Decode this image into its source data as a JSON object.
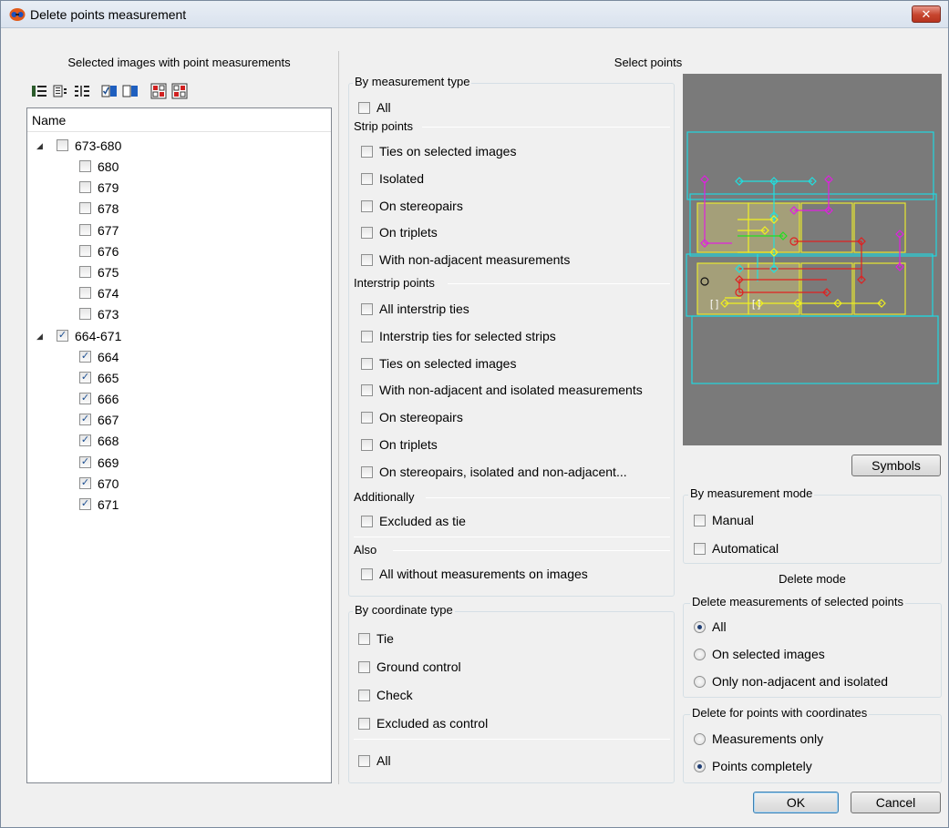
{
  "window": {
    "title": "Delete points measurement",
    "close_label": "✕"
  },
  "left": {
    "header": "Selected images with point measurements",
    "tree_column": "Name",
    "toolbar_icons": [
      "expand-all-icon",
      "collapse-all-icon",
      "tree-view-icon",
      "select-all-icon",
      "deselect-all-icon",
      "check-marked-icon",
      "uncheck-marked-icon"
    ],
    "tree": [
      {
        "label": "673-680",
        "checked": false,
        "children": [
          {
            "label": "680",
            "checked": false
          },
          {
            "label": "679",
            "checked": false
          },
          {
            "label": "678",
            "checked": false
          },
          {
            "label": "677",
            "checked": false
          },
          {
            "label": "676",
            "checked": false
          },
          {
            "label": "675",
            "checked": false
          },
          {
            "label": "674",
            "checked": false
          },
          {
            "label": "673",
            "checked": false
          }
        ]
      },
      {
        "label": "664-671",
        "checked": true,
        "children": [
          {
            "label": "664",
            "checked": true
          },
          {
            "label": "665",
            "checked": true
          },
          {
            "label": "666",
            "checked": true
          },
          {
            "label": "667",
            "checked": true
          },
          {
            "label": "668",
            "checked": true
          },
          {
            "label": "669",
            "checked": true
          },
          {
            "label": "670",
            "checked": true
          },
          {
            "label": "671",
            "checked": true
          }
        ]
      }
    ]
  },
  "select_points": {
    "header": "Select points",
    "by_measurement_type": {
      "title": "By measurement type",
      "all": "All",
      "strip_points_title": "Strip points",
      "strip_points": [
        "Ties on selected images",
        "Isolated",
        "On stereopairs",
        "On triplets",
        "With non-adjacent measurements"
      ],
      "interstrip_title": "Interstrip points",
      "interstrip_points": [
        "All interstrip ties",
        "Interstrip ties for selected strips",
        "Ties on selected images",
        "With non-adjacent and isolated measurements",
        "On stereopairs",
        "On triplets",
        "On stereopairs, isolated and non-adjacent..."
      ],
      "additionally_title": "Additionally",
      "additionally": [
        "Excluded as tie"
      ],
      "also_title": "Also",
      "also": [
        "All without measurements on images"
      ]
    },
    "by_coordinate_type": {
      "title": "By coordinate type",
      "items": [
        "Tie",
        "Ground control",
        "Check",
        "Excluded as control"
      ],
      "all": "All"
    },
    "symbols_button": "Symbols",
    "by_measurement_mode": {
      "title": "By measurement mode",
      "items": [
        "Manual",
        "Automatical"
      ]
    }
  },
  "delete_mode": {
    "header": "Delete mode",
    "measurements_group": {
      "title": "Delete measurements of selected points",
      "options": [
        "All",
        "On selected images",
        "Only non-adjacent and isolated"
      ],
      "selected": "All"
    },
    "coordinates_group": {
      "title": "Delete for points with coordinates",
      "options": [
        "Measurements only",
        "Points completely"
      ],
      "selected": "Points completely"
    }
  },
  "buttons": {
    "ok": "OK",
    "cancel": "Cancel"
  },
  "colors": {
    "preview_bg": "#7a7a7a",
    "strip_frame": "#20d8e0",
    "image_frame": "#e8e830",
    "tie_magenta": "#e020e0",
    "tie_cyan": "#20e0e0",
    "tie_yellow": "#f0f020",
    "tie_green": "#20e020",
    "tie_red": "#e02020"
  },
  "preview_markers": [
    "[ ]",
    "[ ]"
  ]
}
